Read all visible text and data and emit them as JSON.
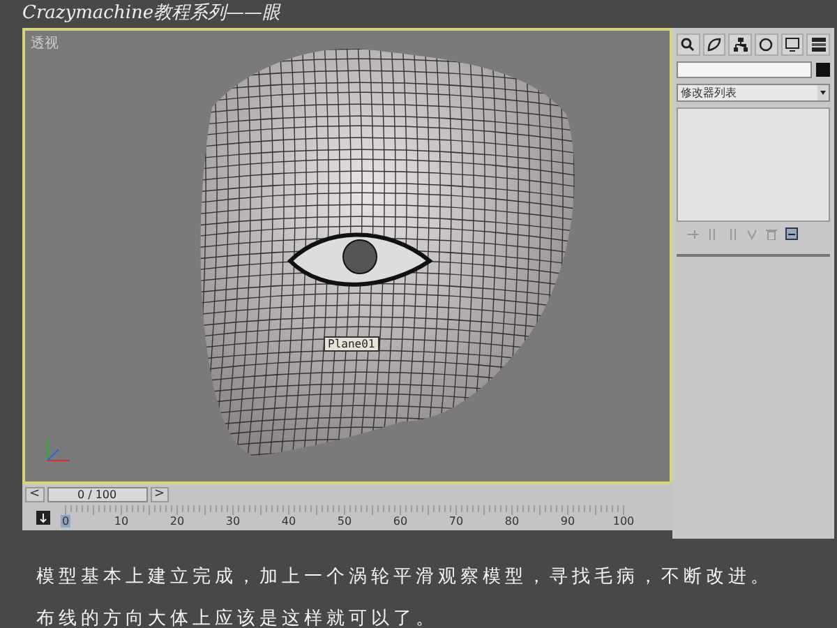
{
  "title": "Crazymachine教程系列——眼",
  "viewport": {
    "label": "透视",
    "object_tooltip": "Plane01"
  },
  "time_slider": {
    "prev": "<",
    "frame": "0 / 100",
    "next": ">"
  },
  "ruler": {
    "labels": [
      {
        "label": "0",
        "selected": true
      },
      {
        "label": "10",
        "selected": false
      },
      {
        "label": "20",
        "selected": false
      },
      {
        "label": "30",
        "selected": false
      },
      {
        "label": "40",
        "selected": false
      },
      {
        "label": "50",
        "selected": false
      },
      {
        "label": "60",
        "selected": false
      },
      {
        "label": "70",
        "selected": false
      },
      {
        "label": "80",
        "selected": false
      },
      {
        "label": "90",
        "selected": false
      },
      {
        "label": "100",
        "selected": false
      }
    ]
  },
  "command_panel": {
    "modifier_list": "修改器列表"
  },
  "caption": [
    "模型基本上建立完成，加上一个涡轮平滑观察模型，寻找毛病，不断改进。",
    "布线的方向大体上应该是这样就可以了。"
  ]
}
